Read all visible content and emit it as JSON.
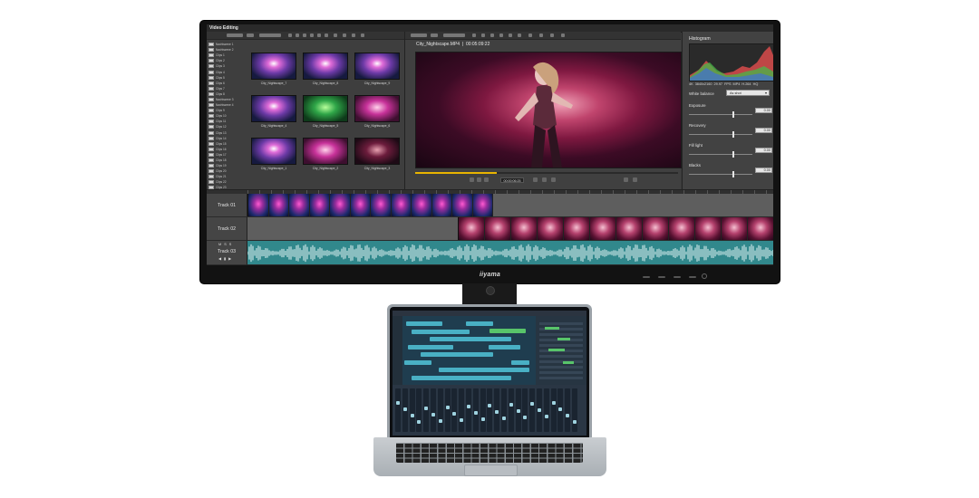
{
  "monitor": {
    "brand": "iiyama",
    "app": {
      "window_title": "Video Editing",
      "viewer": {
        "clip_title": "City_Nightscape.MP4",
        "timecode": "00:05:09:22",
        "transport_timecode": "00:00:06:25"
      },
      "browser": {
        "folders": [
          "Nachtszene 1",
          "Nachtszene 2",
          "Clips 1",
          "Clips 2",
          "Clips 3",
          "Clips 4",
          "Clips 5",
          "Clips 6",
          "Clips 7",
          "Clips 8",
          "Nachtszene 3",
          "Nachtszene 4",
          "Clips 9",
          "Clips 10",
          "Clips 11",
          "Clips 12",
          "Clips 13",
          "Clips 14",
          "Clips 15",
          "Clips 16",
          "Clips 17",
          "Clips 18",
          "Clips 19",
          "Clips 20",
          "Clips 21",
          "Clips 22",
          "Clips 23"
        ],
        "thumbnails": [
          {
            "caption": "City_Nightscape_7",
            "tone": "party"
          },
          {
            "caption": "City_Nightscape_8",
            "tone": "party"
          },
          {
            "caption": "City_Nightscape_9",
            "tone": "party"
          },
          {
            "caption": "City_Nightscape_4",
            "tone": "party"
          },
          {
            "caption": "City_Nightscape_5",
            "tone": "green"
          },
          {
            "caption": "City_Nightscape_6",
            "tone": "pink"
          },
          {
            "caption": "City_Nightscape_1",
            "tone": "party"
          },
          {
            "caption": "City_Nightscape_2",
            "tone": "pink"
          },
          {
            "caption": "City_Nightscape_3",
            "tone": "dark"
          }
        ]
      },
      "inspector": {
        "histogram_title": "Histogram",
        "meta": "4K  3840x2160  29.97 FPS  MP4  H.264  HQ",
        "white_balance_label": "White balance",
        "white_balance_value": "As shot",
        "adjustments": [
          {
            "name": "Exposure",
            "value": "0.00",
            "position": 0.68
          },
          {
            "name": "Recovery",
            "value": "0.00",
            "position": 0.68
          },
          {
            "name": "Fill light",
            "value": "0.00",
            "position": 0.68
          },
          {
            "name": "Blacks",
            "value": "0.00",
            "position": 0.68
          }
        ]
      },
      "timeline": {
        "tracks": [
          {
            "name": "Track 01",
            "type": "video",
            "tone": "blue",
            "frame_count": 12
          },
          {
            "name": "Track 02",
            "type": "video",
            "tone": "pink",
            "frame_count": 12
          },
          {
            "name": "Track 03",
            "type": "audio",
            "controls": "M S S"
          }
        ]
      }
    }
  },
  "colors": {
    "accent_yellow": "#e8b400",
    "audio_teal": "#31888c",
    "panel_grey": "#3e3e3e"
  }
}
